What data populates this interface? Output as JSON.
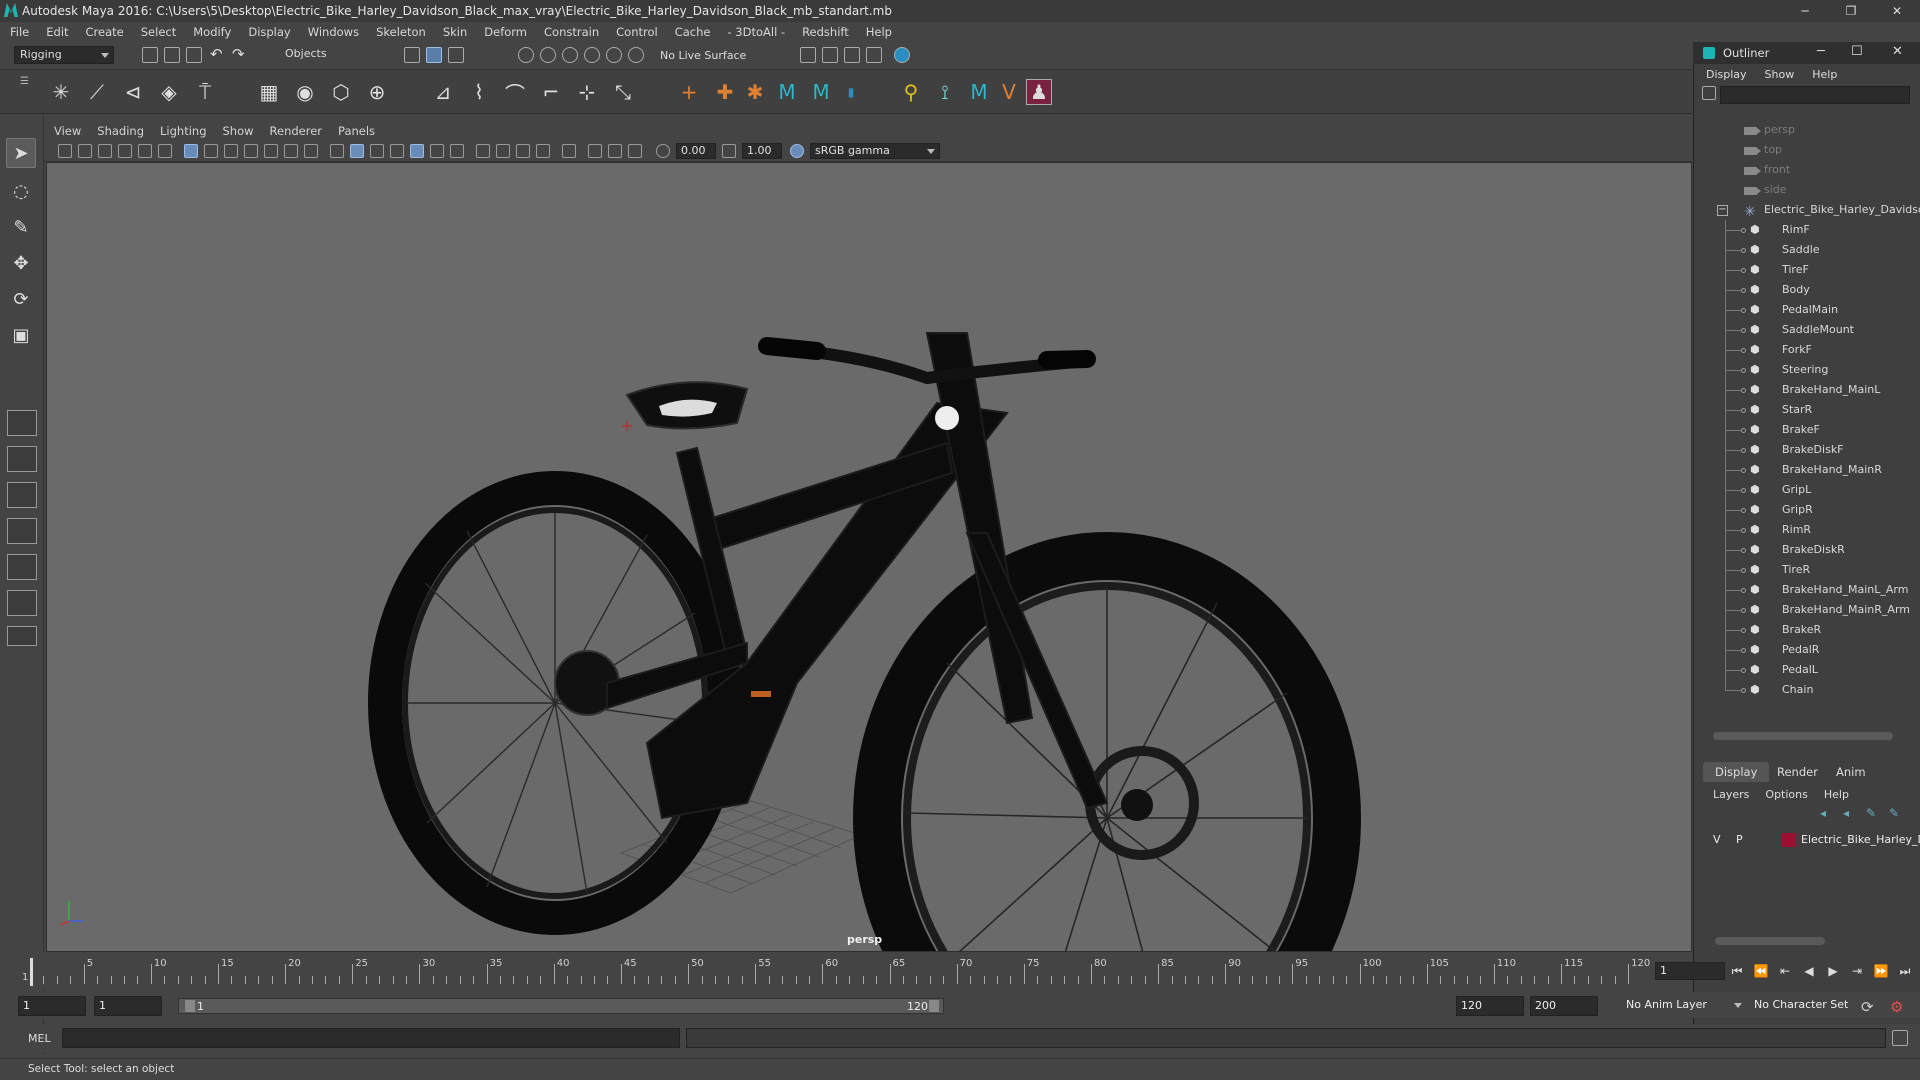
{
  "window": {
    "title": "Autodesk Maya 2016: C:\\Users\\5\\Desktop\\Electric_Bike_Harley_Davidson_Black_max_vray\\Electric_Bike_Harley_Davidson_Black_mb_standart.mb",
    "minimize": "─",
    "maximize": "❐",
    "close": "✕"
  },
  "menubar": [
    "File",
    "Edit",
    "Create",
    "Select",
    "Modify",
    "Display",
    "Windows",
    "Skeleton",
    "Skin",
    "Deform",
    "Constrain",
    "Control",
    "Cache",
    "- 3DtoAll -",
    "Redshift",
    "Help"
  ],
  "status": {
    "menuset": "Rigging",
    "selection_mask": "Objects",
    "live_surface": "No Live Surface"
  },
  "viewport": {
    "menu": [
      "View",
      "Shading",
      "Lighting",
      "Show",
      "Renderer",
      "Panels"
    ],
    "near_value": "0.00",
    "far_value": "1.00",
    "color_space": "sRGB gamma",
    "camera_label": "persp"
  },
  "outliner": {
    "title": "Outliner",
    "menu": [
      "Display",
      "Show",
      "Help"
    ],
    "cameras": [
      "persp",
      "top",
      "front",
      "side"
    ],
    "group": "Electric_Bike_Harley_Davidso",
    "children": [
      "RimF",
      "Saddle",
      "TireF",
      "Body",
      "PedalMain",
      "SaddleMount",
      "ForkF",
      "Steering",
      "BrakeHand_MainL",
      "StarR",
      "BrakeF",
      "BrakeDiskF",
      "BrakeHand_MainR",
      "GripL",
      "GripR",
      "RimR",
      "BrakeDiskR",
      "TireR",
      "BrakeHand_MainL_Arm",
      "BrakeHand_MainR_Arm",
      "BrakeR",
      "PedalR",
      "PedalL",
      "Chain"
    ]
  },
  "layers": {
    "tabs": [
      "Display",
      "Render",
      "Anim"
    ],
    "menu": [
      "Layers",
      "Options",
      "Help"
    ],
    "row": {
      "v": "V",
      "p": "P",
      "name": "Electric_Bike_Harley_D",
      "color": "#9b1030"
    }
  },
  "timeline": {
    "ticks": [
      "5",
      "10",
      "15",
      "20",
      "25",
      "30",
      "35",
      "40",
      "45",
      "50",
      "55",
      "60",
      "65",
      "70",
      "75",
      "80",
      "85",
      "90",
      "95",
      "100",
      "105",
      "110",
      "115",
      "120"
    ],
    "start_tick": "1",
    "current_frame": "1",
    "start_field": "1",
    "start_field2": "1",
    "range_start": "1",
    "range_end": "120",
    "end_field": "120",
    "end_field2": "200",
    "anim_layer": "No Anim Layer",
    "character_set": "No Character Set"
  },
  "cmdline": {
    "label": "MEL"
  },
  "help": {
    "text": "Select Tool: select an object"
  }
}
